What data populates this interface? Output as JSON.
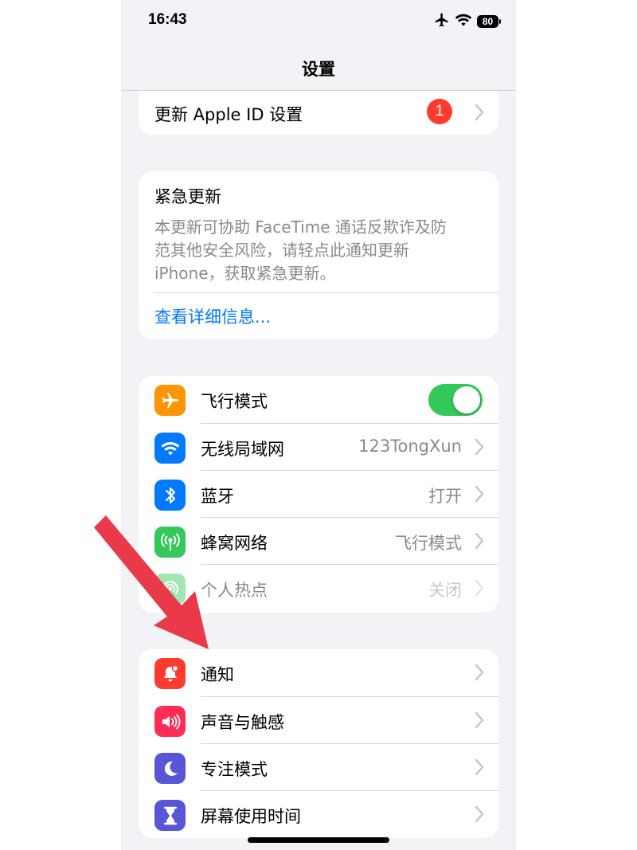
{
  "status_bar": {
    "time": "16:43",
    "battery": "80",
    "icons": [
      "airplane-icon",
      "wifi-icon",
      "battery-icon"
    ]
  },
  "nav": {
    "title": "设置"
  },
  "apple_id_row": {
    "label": "更新 Apple ID 设置",
    "badge": "1"
  },
  "urgent_update": {
    "title": "紧急更新",
    "body_lines": [
      "本更新可协助 FaceTime 通话反欺诈及防",
      "范其他安全风险，请轻点此通知更新",
      "iPhone，获取紧急更新。"
    ],
    "link": "查看详细信息..."
  },
  "connectivity": [
    {
      "label": "飞行模式",
      "icon": "airplane-icon",
      "color": "#ff9500",
      "toggle": true
    },
    {
      "label": "无线局域网",
      "icon": "wifi-icon",
      "color": "#007aff",
      "value": "123TongXun"
    },
    {
      "label": "蓝牙",
      "icon": "bluetooth-icon",
      "color": "#007aff",
      "value": "打开"
    },
    {
      "label": "蜂窝网络",
      "icon": "cellular-icon",
      "color": "#34c759",
      "value": "飞行模式"
    },
    {
      "label": "个人热点",
      "icon": "hotspot-icon",
      "color": "#34c759",
      "value": "关闭",
      "disabled": true
    }
  ],
  "general": [
    {
      "label": "通知",
      "icon": "notification-bell-icon",
      "color": "#ff3b30"
    },
    {
      "label": "声音与触感",
      "icon": "speaker-icon",
      "color": "#ff2d55"
    },
    {
      "label": "专注模式",
      "icon": "moon-icon",
      "color": "#5856d6"
    },
    {
      "label": "屏幕使用时间",
      "icon": "hourglass-icon",
      "color": "#5856d6"
    }
  ],
  "colors": {
    "accent_link": "#007aff",
    "annotation_arrow": "#ea3a4a"
  }
}
